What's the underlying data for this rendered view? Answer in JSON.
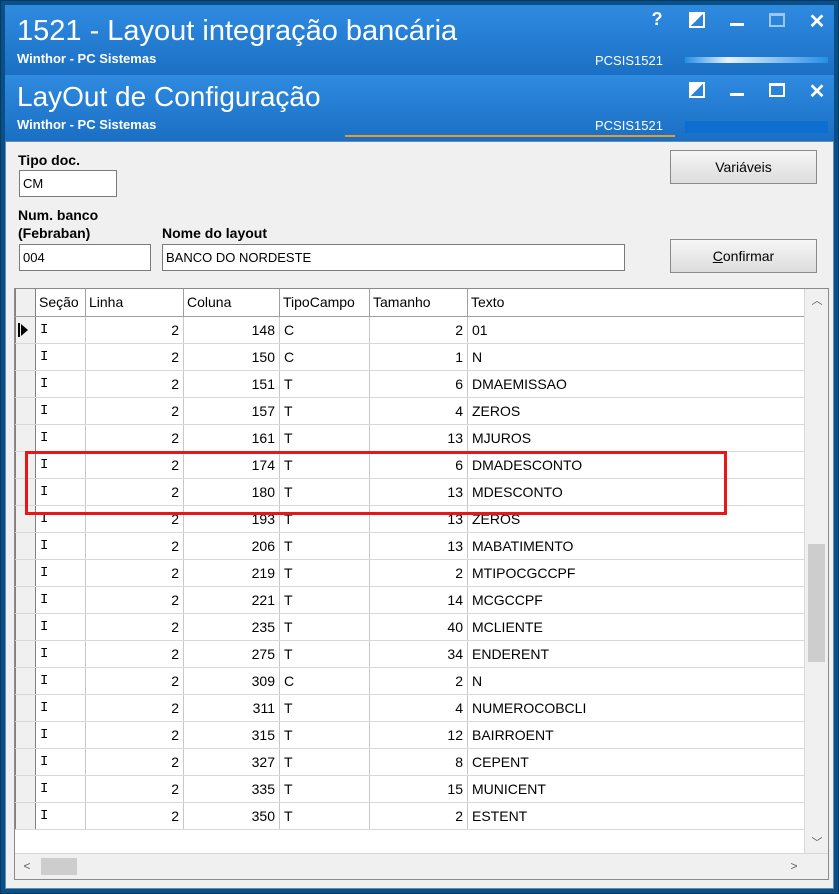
{
  "outer_window": {
    "title": "1521 - Layout integração bancária",
    "subtitle": "Winthor - PC Sistemas",
    "code": "PCSIS1521",
    "help_label": "?"
  },
  "inner_window": {
    "title": "LayOut de Configuração",
    "subtitle": "Winthor - PC Sistemas",
    "code": "PCSIS1521"
  },
  "form": {
    "tipo_doc_label": "Tipo doc.",
    "tipo_doc_value": "CM",
    "num_banco_label_1": "Num. banco",
    "num_banco_label_2": "(Febraban)",
    "num_banco_value": "004",
    "nome_layout_label": "Nome do layout",
    "nome_layout_value": "BANCO DO NORDESTE",
    "variaveis_button": "Variáveis",
    "confirmar_button_c": "C",
    "confirmar_button_rest": "onfirmar"
  },
  "grid": {
    "columns": [
      "Seção",
      "Linha",
      "Coluna",
      "TipoCampo",
      "Tamanho",
      "Texto"
    ],
    "rows": [
      [
        "I",
        "2",
        "148",
        "C",
        "2",
        "01"
      ],
      [
        "I",
        "2",
        "150",
        "C",
        "1",
        "N"
      ],
      [
        "I",
        "2",
        "151",
        "T",
        "6",
        "DMAEMISSAO"
      ],
      [
        "I",
        "2",
        "157",
        "T",
        "4",
        "ZEROS"
      ],
      [
        "I",
        "2",
        "161",
        "T",
        "13",
        "MJUROS"
      ],
      [
        "I",
        "2",
        "174",
        "T",
        "6",
        "DMADESCONTO"
      ],
      [
        "I",
        "2",
        "180",
        "T",
        "13",
        "MDESCONTO"
      ],
      [
        "I",
        "2",
        "193",
        "T",
        "13",
        "ZEROS"
      ],
      [
        "I",
        "2",
        "206",
        "T",
        "13",
        "MABATIMENTO"
      ],
      [
        "I",
        "2",
        "219",
        "T",
        "2",
        "MTIPOCGCCPF"
      ],
      [
        "I",
        "2",
        "221",
        "T",
        "14",
        "MCGCCPF"
      ],
      [
        "I",
        "2",
        "235",
        "T",
        "40",
        "MCLIENTE"
      ],
      [
        "I",
        "2",
        "275",
        "T",
        "34",
        "ENDERENT"
      ],
      [
        "I",
        "2",
        "309",
        "C",
        "2",
        "N"
      ],
      [
        "I",
        "2",
        "311",
        "T",
        "4",
        "NUMEROCOBCLI"
      ],
      [
        "I",
        "2",
        "315",
        "T",
        "12",
        "BAIRROENT"
      ],
      [
        "I",
        "2",
        "327",
        "T",
        "8",
        "CEPENT"
      ],
      [
        "I",
        "2",
        "335",
        "T",
        "15",
        "MUNICENT"
      ],
      [
        "I",
        "2",
        "350",
        "T",
        "2",
        "ESTENT"
      ]
    ],
    "selected_row": 0,
    "highlighted_rows": [
      5,
      6
    ],
    "highlight_color": "#e8161a"
  },
  "colors": {
    "titlebar": "#1a6fc4",
    "window_bg": "#f0f0f0"
  }
}
